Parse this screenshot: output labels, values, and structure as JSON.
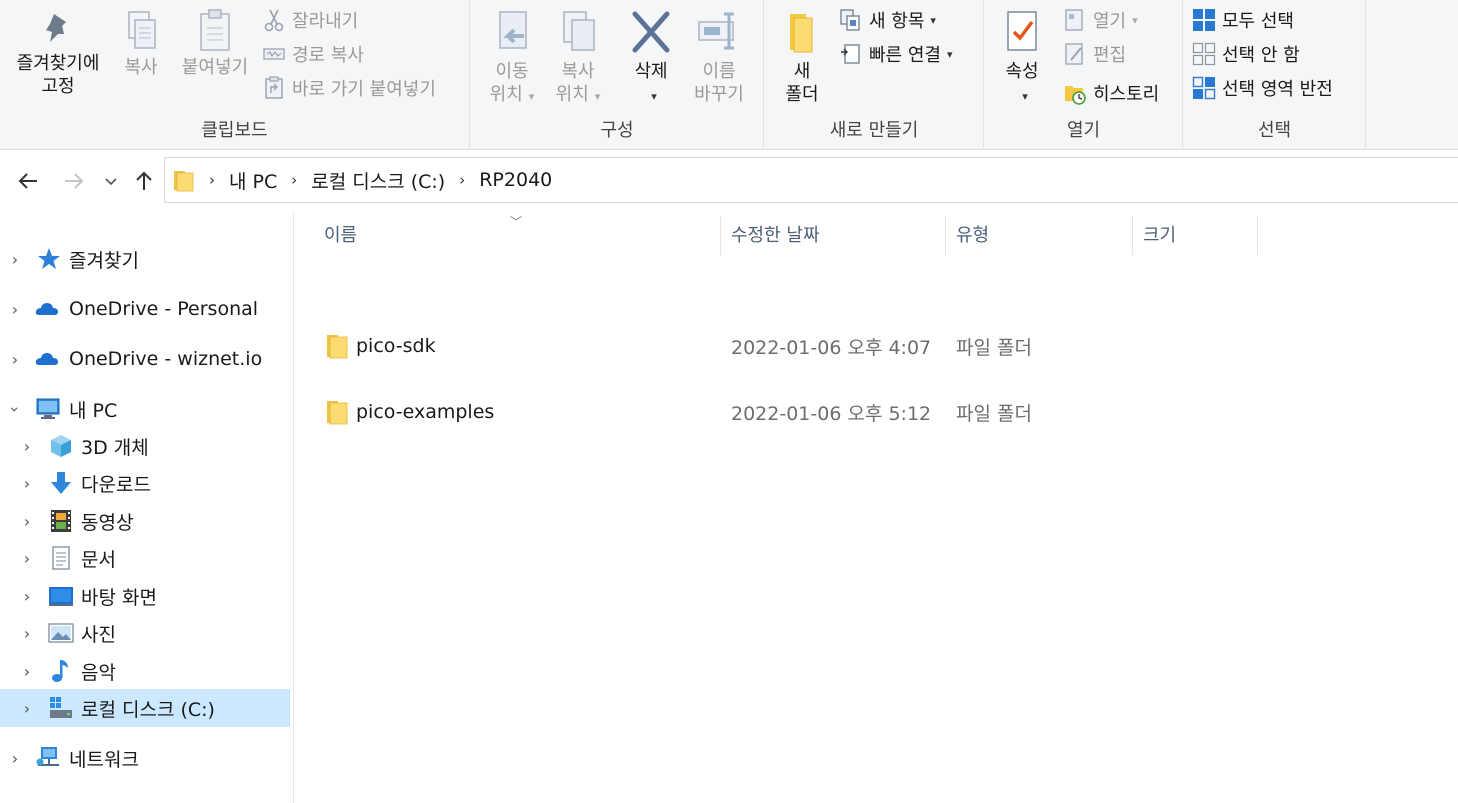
{
  "ribbon": {
    "clipboard": {
      "label": "클립보드",
      "pin_line1": "즐겨찾기에",
      "pin_line2": "고정",
      "copy": "복사",
      "paste": "붙여넣기",
      "cut": "잘라내기",
      "copy_path": "경로 복사",
      "paste_shortcut": "바로 가기 붙여넣기"
    },
    "organize": {
      "label": "구성",
      "move_line1": "이동",
      "move_line2": "위치",
      "copyto_line1": "복사",
      "copyto_line2": "위치",
      "delete": "삭제",
      "rename_line1": "이름",
      "rename_line2": "바꾸기"
    },
    "new": {
      "label": "새로 만들기",
      "folder_line1": "새",
      "folder_line2": "폴더",
      "new_item": "새 항목",
      "easy_access": "빠른 연결"
    },
    "open": {
      "label": "열기",
      "properties": "속성",
      "open": "열기",
      "edit": "편집",
      "history": "히스토리"
    },
    "select": {
      "label": "선택",
      "select_all": "모두 선택",
      "select_none": "선택 안 함",
      "invert": "선택 영역 반전"
    }
  },
  "address": {
    "crumbs": [
      "내 PC",
      "로컬 디스크 (C:)",
      "RP2040"
    ]
  },
  "sidebar": {
    "items": [
      {
        "label": "즐겨찾기"
      },
      {
        "label": "OneDrive - Personal"
      },
      {
        "label": "OneDrive - wiznet.io"
      },
      {
        "label": "내 PC"
      },
      {
        "label": "3D 개체"
      },
      {
        "label": "다운로드"
      },
      {
        "label": "동영상"
      },
      {
        "label": "문서"
      },
      {
        "label": "바탕 화면"
      },
      {
        "label": "사진"
      },
      {
        "label": "음악"
      },
      {
        "label": "로컬 디스크 (C:)"
      },
      {
        "label": "네트워크"
      }
    ]
  },
  "columns": {
    "name": "이름",
    "date": "수정한 날짜",
    "type": "유형",
    "size": "크기"
  },
  "files": [
    {
      "name": "pico-sdk",
      "date": "2022-01-06 오후 4:07",
      "type": "파일 폴더"
    },
    {
      "name": "pico-examples",
      "date": "2022-01-06 오후 5:12",
      "type": "파일 폴더"
    }
  ],
  "colors": {
    "selection": "#cce8ff",
    "folder": "#f8d775",
    "accent": "#1f6fd1"
  }
}
